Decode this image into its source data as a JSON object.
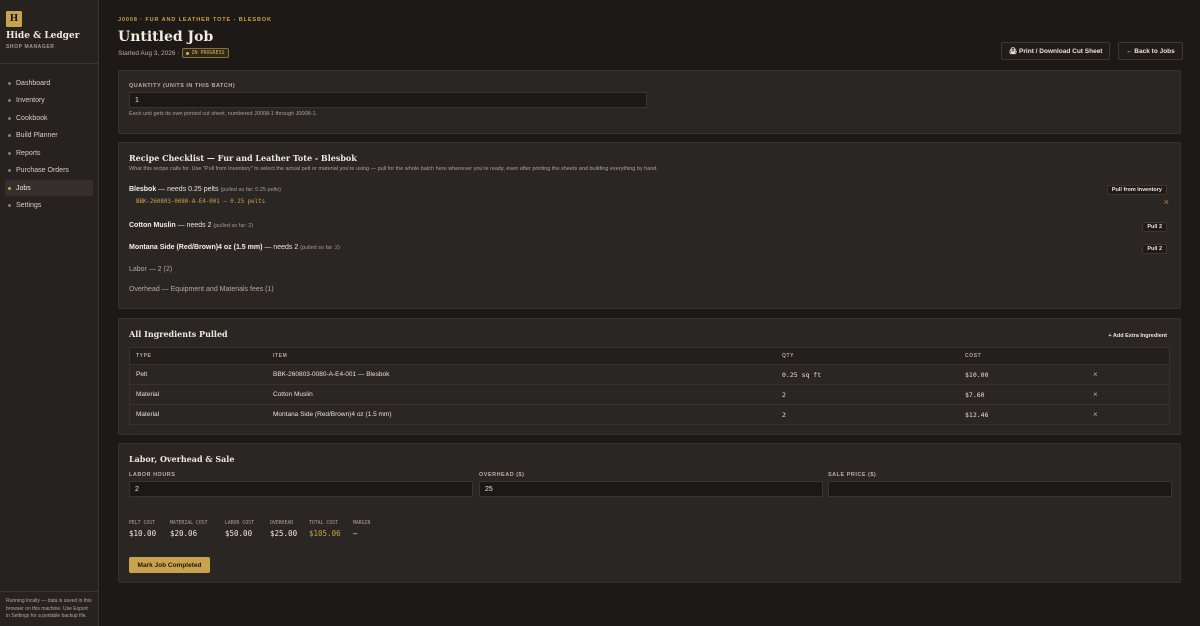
{
  "brand": {
    "logo_letter": "H",
    "name": "Hide & Ledger",
    "subtitle": "SHOP MANAGER"
  },
  "nav": [
    {
      "label": "Dashboard"
    },
    {
      "label": "Inventory"
    },
    {
      "label": "Cookbook"
    },
    {
      "label": "Build Planner"
    },
    {
      "label": "Reports"
    },
    {
      "label": "Purchase Orders"
    },
    {
      "label": "Jobs",
      "active": true
    },
    {
      "label": "Settings"
    }
  ],
  "footer_note": "Running locally — data is saved in this browser on this machine. Use Export in Settings for a portable backup file.",
  "header": {
    "breadcrumb": "J0008 · FUR AND LEATHER TOTE - BLESBOK",
    "title": "Untitled Job",
    "started": "Started Aug 3, 2026 ·",
    "status": "IN PROGRESS",
    "print_label": "🖨 Print / Download Cut Sheet",
    "back_label": "← Back to Jobs"
  },
  "quantity": {
    "label": "QUANTITY (UNITS IN THIS BATCH)",
    "value": "1",
    "help": "Each unit gets its own printed cut sheet, numbered J0008-1 through J0008-1."
  },
  "checklist": {
    "title": "Recipe Checklist — Fur and Leather Tote - Blesbok",
    "help": "What this recipe calls for. Use \"Pull from Inventory\" to select the actual pelt or material you're using — pull for the whole batch here whenever you're ready, even after printing the sheets and building everything by hand.",
    "items": [
      {
        "name": "Blesbok",
        "need": " — needs 0.25 pelts",
        "note": "(pulled so far: 0.25 pelts)",
        "button": "Pull from Inventory",
        "pulled": "BBK-260803-0080-A-E4-001 — 0.25 pelts"
      },
      {
        "name": "Cotton Muslin",
        "need": " — needs 2",
        "note": "(pulled so far: 2)",
        "button": "Pull 2"
      },
      {
        "name": "Montana Side (Red/Brown)4 oz (1.5 mm)",
        "need": " — needs 2",
        "note": "(pulled so far: 2)",
        "button": "Pull 2"
      }
    ],
    "labor": "Labor — 2 (2)",
    "overhead": "Overhead — Equipment and Materials fees (1)"
  },
  "ingredients": {
    "title": "All Ingredients Pulled",
    "add_label": "+ Add Extra Ingredient",
    "columns": [
      "TYPE",
      "ITEM",
      "QTY",
      "COST"
    ],
    "rows": [
      {
        "type": "Pelt",
        "item": "BBK-260803-0080-A-E4-001 — Blesbok",
        "qty": "0.25 sq ft",
        "cost": "$10.00"
      },
      {
        "type": "Material",
        "item": "Cotton Muslin",
        "qty": "2",
        "cost": "$7.60"
      },
      {
        "type": "Material",
        "item": "Montana Side (Red/Brown)4 oz (1.5 mm)",
        "qty": "2",
        "cost": "$12.46"
      }
    ],
    "remove_glyph": "×"
  },
  "labor_section": {
    "title": "Labor, Overhead & Sale",
    "labor_label": "LABOR HOURS",
    "labor_value": "2",
    "overhead_label": "OVERHEAD ($)",
    "overhead_value": "25",
    "sale_label": "SALE PRICE ($)",
    "sale_value": "",
    "stats": [
      {
        "label": "PELT COST",
        "value": "$10.00"
      },
      {
        "label": "MATERIAL COST",
        "value": "$20.06"
      },
      {
        "label": "LABOR COST",
        "value": "$50.00"
      },
      {
        "label": "OVERHEAD",
        "value": "$25.00"
      },
      {
        "label": "TOTAL COST",
        "value": "$105.06",
        "accent": true
      },
      {
        "label": "MARGIN",
        "value": "—"
      }
    ],
    "complete_label": "Mark Job Completed"
  },
  "colors": {
    "accent": "#c9a24d",
    "background": "#1c1916",
    "card": "#2a2623",
    "remove": "#d0793a"
  }
}
